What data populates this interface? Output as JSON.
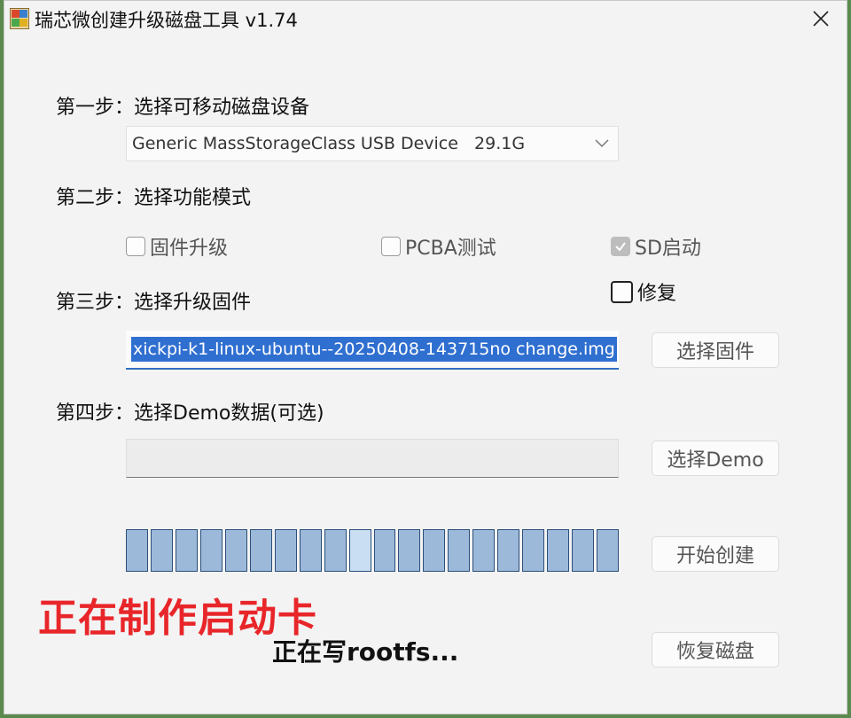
{
  "window": {
    "title": "瑞芯微创建升级磁盘工具 v1.74"
  },
  "steps": {
    "step1": "第一步：选择可移动磁盘设备",
    "step2": "第二步：选择功能模式",
    "step3": "第三步：选择升级固件",
    "step4": "第四步：选择Demo数据(可选)"
  },
  "device": {
    "selected": "Generic MassStorageClass USB Device   29.1G"
  },
  "modes": {
    "firmware_upgrade": {
      "label": "固件升级",
      "checked": false
    },
    "pcba_test": {
      "label": "PCBA测试",
      "checked": false
    },
    "sd_boot": {
      "label": "SD启动",
      "checked": true,
      "disabled": true
    },
    "repair": {
      "label": "修复",
      "checked": false
    }
  },
  "firmware": {
    "path": "xickpi-k1-linux-ubuntu--20250408-143715no change.img",
    "choose_label": "选择固件"
  },
  "demo": {
    "path": "",
    "choose_label": "选择Demo"
  },
  "progress": {
    "segments_total": 20,
    "active_segment": 10
  },
  "actions": {
    "start_label": "开始创建",
    "restore_label": "恢复磁盘"
  },
  "status": {
    "overlay": "正在制作启动卡",
    "message": "正在写rootfs..."
  },
  "colors": {
    "accent": "#2f6fd0",
    "progress_fill": "#9db9d9",
    "status_red": "#e8262a"
  }
}
